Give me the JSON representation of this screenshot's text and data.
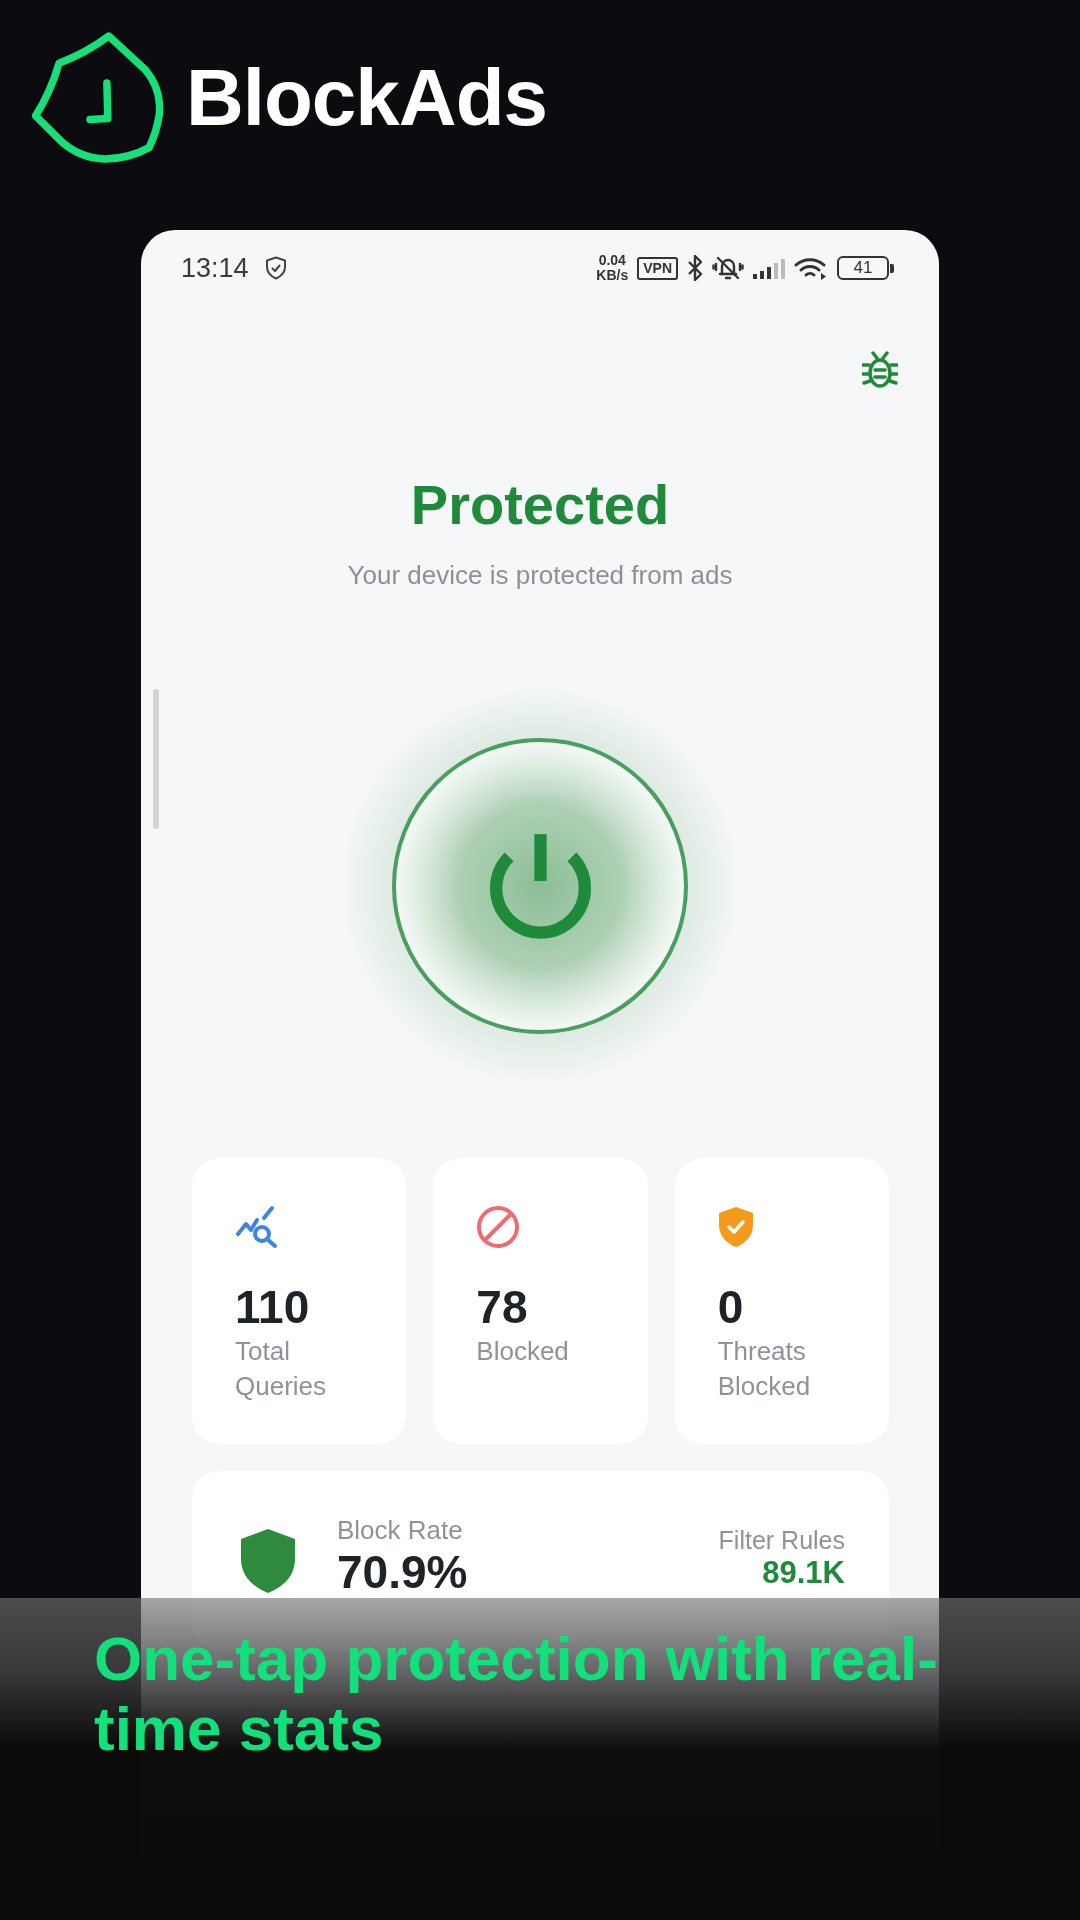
{
  "brand": {
    "name": "BlockAds"
  },
  "status_bar": {
    "time": "13:14",
    "speed_value": "0.04",
    "speed_unit": "KB/s",
    "vpn": "VPN",
    "battery": "41"
  },
  "header": {
    "title": "Protected",
    "subtitle": "Your device is protected from ads"
  },
  "power_button": {
    "on": true
  },
  "stats": [
    {
      "kind": "queries",
      "value": "110",
      "label": "Total Queries"
    },
    {
      "kind": "blocked",
      "value": "78",
      "label": "Blocked"
    },
    {
      "kind": "threats",
      "value": "0",
      "label": "Threats Blocked"
    }
  ],
  "summary": {
    "block_rate_label": "Block Rate",
    "block_rate": "70.9%",
    "filter_rules_label": "Filter Rules",
    "filter_rules": "89.1K"
  },
  "caption": "One-tap protection with real-time stats"
}
